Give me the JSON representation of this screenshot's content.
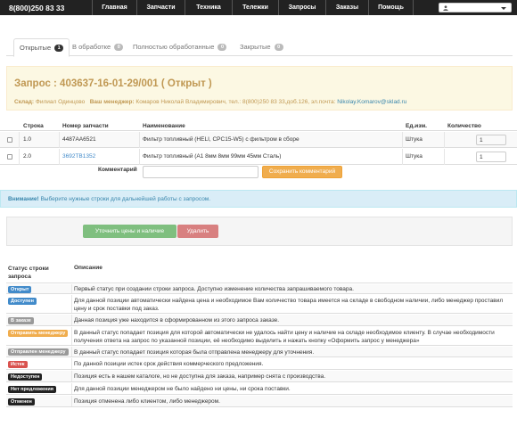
{
  "navbar": {
    "brand": "8(800)250 83 33",
    "items": [
      "Главная",
      "Запчасти",
      "Техника",
      "Тележки",
      "Запросы",
      "Заказы",
      "Помощь"
    ]
  },
  "tabs": [
    {
      "label": "Открытые",
      "count": "1"
    },
    {
      "label": "В обработке",
      "count": "0"
    },
    {
      "label": "Полностью обработанные",
      "count": "0"
    },
    {
      "label": "Закрытые",
      "count": "0"
    }
  ],
  "request": {
    "title": "Запрос : 403637-16-01-29/001  ( Открыт )",
    "warehouse_label": "Склад:",
    "warehouse_value": "Филиал Одинцово",
    "manager_label": "Ваш менеджер:",
    "manager_value": "Комаров Николай Владимирович, тел.: 8(800)250 83 33,доб.126, эл.почта:",
    "manager_email": "Nikolay.Komarov@sklad.ru"
  },
  "items_table": {
    "headers": [
      "Строка",
      "Номер запчасти",
      "Наименование",
      "Ед.изм.",
      "Количество"
    ],
    "rows": [
      {
        "line": "1.0",
        "part": "4487AA6521",
        "name": "Фильтр топливный (HELI, CPC15-W5) с фильтром в сборе",
        "unit": "Штука",
        "qty": "1"
      },
      {
        "line": "2.0",
        "part": "3692TB1352",
        "name": "Фильтр топливный (A1 8мм 8мм 99мм 45мм Сталь)",
        "unit": "Штука",
        "qty": "1"
      }
    ]
  },
  "comment": {
    "label": "Комментарий",
    "save_label": "Сохранить комментарий"
  },
  "alert": {
    "strong": "Внимание!",
    "text": " Выберите нужные строки для дальнейшей работы с запросом."
  },
  "actions": {
    "check_prices": "Уточнить цены и наличие",
    "delete": "Удалить"
  },
  "legend": {
    "header_status": "Статус строки запроса",
    "header_desc": "Описание",
    "rows": [
      {
        "label": "Открыт",
        "color": "#428bca",
        "desc": "Первый статус при создании строки запроса. Доступно изменение количества запрашиваемого товара."
      },
      {
        "label": "Доступен",
        "color": "#428bca",
        "desc": "Для данной позиции автоматически найдена цена и необходимое Вам количество товара имеется на складе в свободном наличии, либо менеджер проставил цену и срок поставки под заказ."
      },
      {
        "label": "В заказе",
        "color": "#999999",
        "desc": "Данная позиция уже находится в сформированном из этого запроса заказе."
      },
      {
        "label": "Отправить менеджеру",
        "color": "#f0ad4e",
        "desc": "В данный статус попадает позиция для которой автоматически не удалось найти цену и наличие на складе необходимое клиенту. В случае необходимости получения ответа на запрос по указанной позиции, её необходимо выделить и нажать кнопку «Оформить запрос у менеджера»"
      },
      {
        "label": "Отправлен менеджеру",
        "color": "#999999",
        "desc": "В данный статус попадает позиция которая была отправлена менеджеру для уточнения."
      },
      {
        "label": "Истек",
        "color": "#d9534f",
        "desc": "По данной позиции истек срок действия коммерческого предложения."
      },
      {
        "label": "Недоступен",
        "color": "#222222",
        "desc": "Позиция есть в нашем каталоге, но не доступна для заказа, например снята с производства."
      },
      {
        "label": "Нет предложения",
        "color": "#222222",
        "desc": "Для данной позиции менеджером не было найдено ни цены, ни срока поставки."
      },
      {
        "label": "Отменен",
        "color": "#222222",
        "desc": "Позиция отменена либо клиентом, либо менеджером."
      }
    ]
  }
}
